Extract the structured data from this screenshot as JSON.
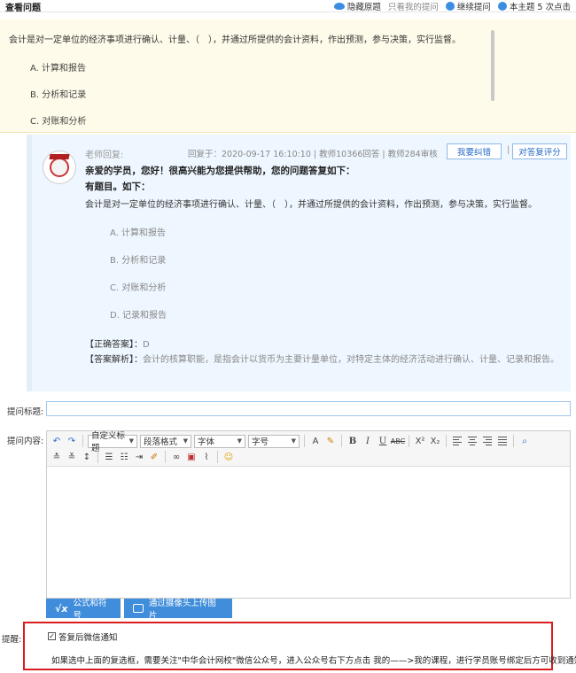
{
  "header": {
    "title": "查看问题",
    "hide_original": "隐藏原题",
    "only_my": "只看我的提问",
    "continue": "继续提问",
    "theme_clicks": "本主题 5 次点击"
  },
  "question": {
    "text": "会计是对一定单位的经济事项进行确认、计量、（　），并通过所提供的会计资料，作出预测，参与决策，实行监督。",
    "options": [
      "A. 计算和报告",
      "B. 分析和记录",
      "C. 对账和分析"
    ]
  },
  "reply": {
    "label": "老师回复:",
    "meta": "回复于：2020-09-17 16:10:10 | 教师10366回答 | 教师284审核",
    "report_btn": "我要纠错",
    "separator": "|",
    "rate_btn": "对答复评分",
    "greeting": "亲爱的学员，您好！很高兴能为您提供帮助，您的问题答复如下：",
    "subheading": "有题目。如下：",
    "question": "会计是对一定单位的经济事项进行确认、计量、（　），并通过所提供的会计资料，作出预测，参与决策，实行监督。",
    "options": [
      "A. 计算和报告",
      "B. 分析和记录",
      "C. 对账和分析",
      "D. 记录和报告"
    ],
    "answer_label": "【正确答案】：",
    "answer_value": "D",
    "explain_label": "【答案解析】：",
    "explain_value": "会计的核算职能，是指会计以货币为主要计量单位，对特定主体的经济活动进行确认、计量、记录和报告。"
  },
  "form": {
    "title_label": "提问标题:",
    "content_label": "提问内容:",
    "title_value": "",
    "toolbar": {
      "custom_title": "自定义标题",
      "paragraph": "段落格式",
      "font": "字体",
      "size": "字号"
    },
    "formula_btn": "公式和符号",
    "camera_btn": "通过摄像头上传图片"
  },
  "notify": {
    "remind_label": "提醒:",
    "checkbox_label": "答复后微信通知",
    "checked": true,
    "info": "如果选中上面的复选框，需要关注\"中华会计网校\"微信公众号，进入公众号右下方点击 我的——>我的课程，进行学员账号绑定后方可收到通知。"
  },
  "colors": {
    "accent": "#3f8ddb",
    "question_bg": "#fffbea",
    "reply_bg": "#eef7ff",
    "alert_border": "#d81e1e"
  }
}
